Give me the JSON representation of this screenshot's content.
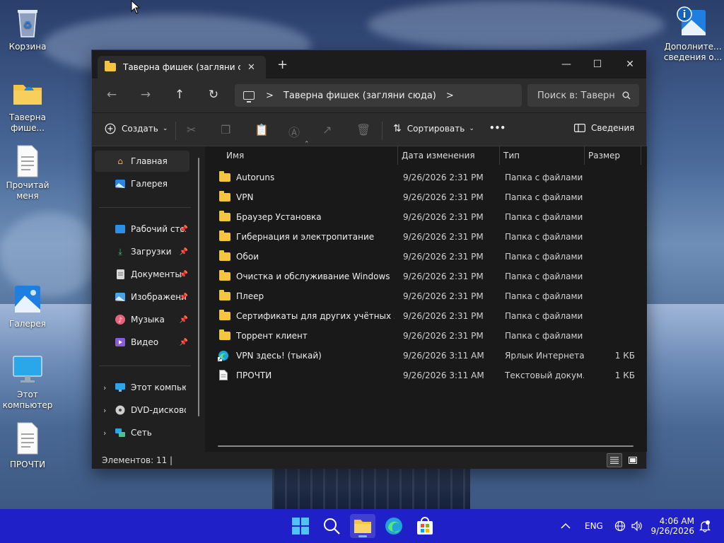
{
  "desktop": {
    "icons": [
      {
        "label": "Корзина"
      },
      {
        "label": "Таверна фише..."
      },
      {
        "label": "Прочитай меня"
      },
      {
        "label": "Галерея"
      },
      {
        "label": "Этот компьютер"
      },
      {
        "label": "ПРОЧТИ"
      },
      {
        "label": "Дополните... сведения о..."
      }
    ]
  },
  "window": {
    "tab_title": "Таверна фишек (загляни сюда)",
    "tab_close": "✕",
    "tab_add": "+",
    "minimize": "—",
    "maximize": "☐",
    "close": "✕",
    "nav": {
      "back": "←",
      "forward": "→",
      "up": "↑",
      "refresh": "↻"
    },
    "address": {
      "path": "Таверна фишек (загляни сюда)",
      "sep": ">",
      "sep_end": ">"
    },
    "search": {
      "placeholder": "Поиск в: Таверна фишек"
    },
    "toolbar": {
      "new": "Создать",
      "sort": "Сортировать",
      "more": "•••",
      "details": "Сведения"
    },
    "sidebar": {
      "items": [
        {
          "label": "Главная"
        },
        {
          "label": "Галерея"
        },
        {
          "label": "Рабочий стол"
        },
        {
          "label": "Загрузки"
        },
        {
          "label": "Документы"
        },
        {
          "label": "Изображения"
        },
        {
          "label": "Музыка"
        },
        {
          "label": "Видео"
        },
        {
          "label": "Этот компьютер"
        },
        {
          "label": "DVD-дисковод (D:)"
        },
        {
          "label": "Сеть"
        }
      ]
    },
    "columns": {
      "name": "Имя",
      "date": "Дата изменения",
      "type": "Тип",
      "size": "Размер"
    },
    "files": [
      {
        "name": "Autoruns",
        "date": "9/26/2026 2:31 PM",
        "type": "Папка с файлами",
        "size": "",
        "icon": "folder-icon"
      },
      {
        "name": "VPN",
        "date": "9/26/2026 2:31 PM",
        "type": "Папка с файлами",
        "size": "",
        "icon": "folder-icon"
      },
      {
        "name": "Браузер Установка",
        "date": "9/26/2026 2:31 PM",
        "type": "Папка с файлами",
        "size": "",
        "icon": "folder-icon"
      },
      {
        "name": "Гибернация и электропитание",
        "date": "9/26/2026 2:31 PM",
        "type": "Папка с файлами",
        "size": "",
        "icon": "folder-icon"
      },
      {
        "name": "Обои",
        "date": "9/26/2026 2:31 PM",
        "type": "Папка с файлами",
        "size": "",
        "icon": "folder-icon"
      },
      {
        "name": "Очистка и обслуживание Windows",
        "date": "9/26/2026 2:31 PM",
        "type": "Папка с файлами",
        "size": "",
        "icon": "folder-icon"
      },
      {
        "name": "Плеер",
        "date": "9/26/2026 2:31 PM",
        "type": "Папка с файлами",
        "size": "",
        "icon": "folder-icon"
      },
      {
        "name": "Сертификаты для других учётных запи...",
        "date": "9/26/2026 2:31 PM",
        "type": "Папка с файлами",
        "size": "",
        "icon": "folder-icon"
      },
      {
        "name": "Торрент клиент",
        "date": "9/26/2026 2:31 PM",
        "type": "Папка с файлами",
        "size": "",
        "icon": "folder-icon"
      },
      {
        "name": "VPN здесь! (тыкай)",
        "date": "9/26/2026 3:11 AM",
        "type": "Ярлык Интернета",
        "size": "1 КБ",
        "icon": "edge-shortcut-icon"
      },
      {
        "name": "ПРОЧТИ",
        "date": "9/26/2026 3:11 AM",
        "type": "Текстовый докум...",
        "size": "1 КБ",
        "icon": "text-file-icon"
      }
    ],
    "status": "Элементов: 11  |"
  },
  "taskbar": {
    "lang": "ENG",
    "time": "4:06 AM",
    "date": "9/26/2026",
    "chevron": "^"
  }
}
